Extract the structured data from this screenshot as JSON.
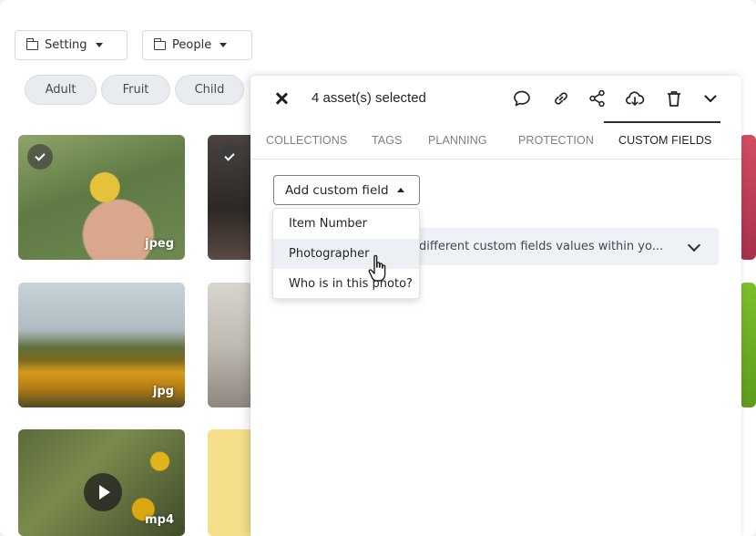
{
  "filters": [
    {
      "label": "Setting",
      "icon": "folder-icon"
    },
    {
      "label": "People",
      "icon": "folder-icon"
    }
  ],
  "tags": [
    "Adult",
    "Fruit",
    "Child"
  ],
  "thumbnails": [
    {
      "ext": "jpeg",
      "selected": true
    },
    {
      "ext": "",
      "selected": true
    },
    {
      "ext": "jpg",
      "selected": false
    },
    {
      "ext": "mp4",
      "selected": false,
      "video": true
    }
  ],
  "panel": {
    "selection_text": "4 asset(s) selected",
    "header_icons": [
      "comment-icon",
      "link-icon",
      "share-icon",
      "download-icon",
      "trash-icon",
      "chevron-down-icon"
    ],
    "tabs": [
      {
        "label": "COLLECTIONS"
      },
      {
        "label": "TAGS"
      },
      {
        "label": "PLANNING"
      },
      {
        "label": "PROTECTION"
      },
      {
        "label": "CUSTOM FIELDS",
        "active": true
      }
    ],
    "add_field_label": "Add custom field",
    "dropdown_items": [
      "Item Number",
      "Photographer",
      "Who is in this photo?"
    ],
    "hovered_item": "Photographer",
    "info_text": "different custom fields values within yo..."
  }
}
